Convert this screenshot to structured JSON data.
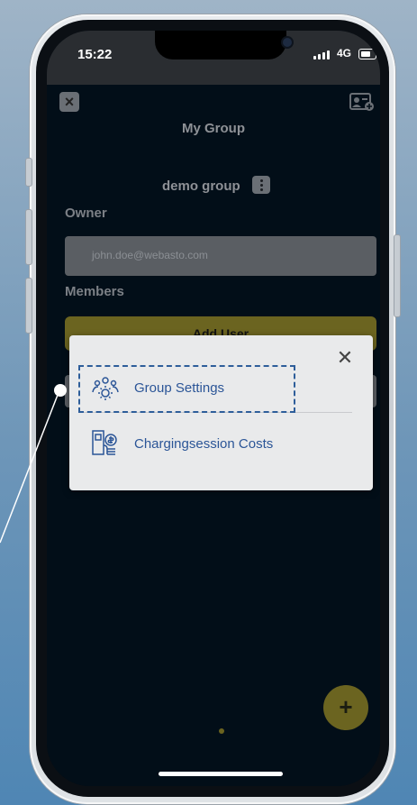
{
  "status_bar": {
    "time": "15:22",
    "network": "4G",
    "signal_icon": "signal-bars-icon",
    "battery_icon": "battery-icon"
  },
  "header": {
    "title": "My Group",
    "close_icon": "close-icon",
    "contact_icon": "contact-card-add-icon"
  },
  "group": {
    "name": "demo group",
    "menu_icon": "kebab-menu-icon"
  },
  "owner": {
    "label": "Owner",
    "email": "john.doe@webasto.com"
  },
  "members": {
    "label": "Members",
    "add_user_label": "Add User"
  },
  "fab": {
    "label": "+"
  },
  "modal": {
    "close_label": "✕",
    "items": [
      {
        "label": "Group Settings",
        "icon": "group-settings-icon"
      },
      {
        "label": "Chargingsession Costs",
        "icon": "charging-costs-icon"
      }
    ]
  },
  "colors": {
    "background": "#020e18",
    "accent_yellow": "#6b6420",
    "modal_text": "#2b5597",
    "highlight": "#2e5e9a"
  }
}
